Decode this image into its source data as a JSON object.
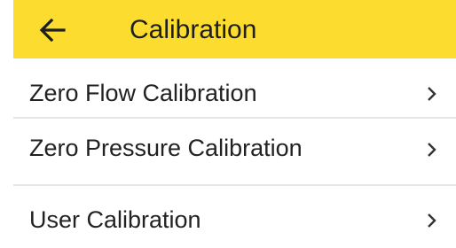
{
  "header": {
    "back_icon": "arrow-left-icon",
    "title": "Calibration"
  },
  "colors": {
    "header_background": "#fcdc2e",
    "text": "#222222",
    "divider": "#e6e6e6"
  },
  "menu": {
    "items": [
      {
        "label": "Zero Flow Calibration",
        "icon": "chevron-right-icon"
      },
      {
        "label": "Zero Pressure Calibration",
        "icon": "chevron-right-icon"
      },
      {
        "label": "User Calibration",
        "icon": "chevron-right-icon"
      }
    ]
  }
}
